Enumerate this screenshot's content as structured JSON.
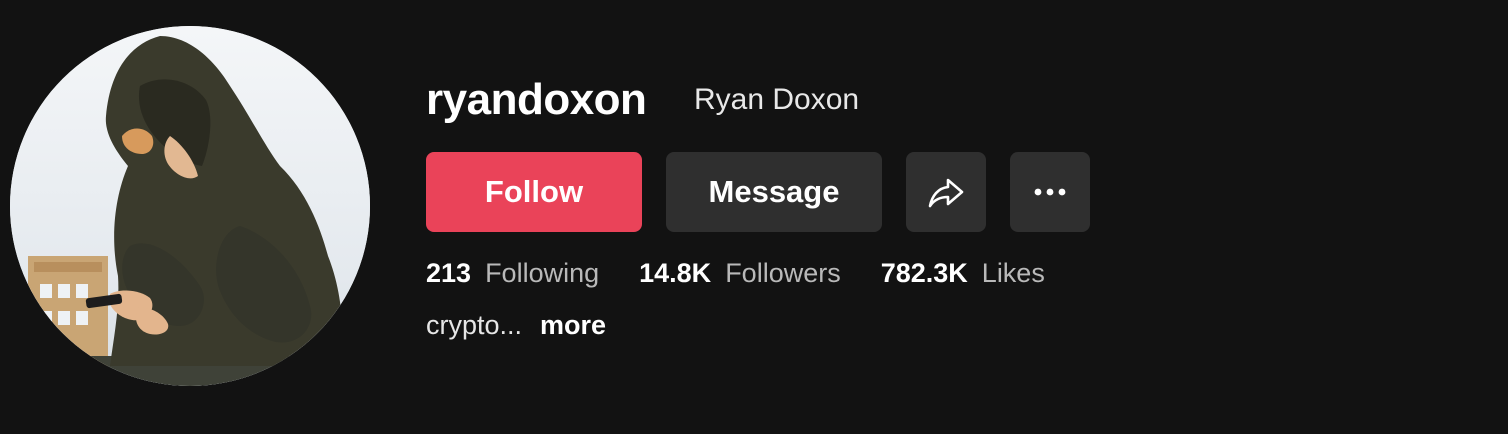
{
  "profile": {
    "username": "ryandoxon",
    "nickname": "Ryan Doxon",
    "avatar_alt": "profile photo of person in hoodie looking at phone"
  },
  "actions": {
    "follow_label": "Follow",
    "message_label": "Message",
    "share_icon": "share-arrow-icon",
    "more_icon": "ellipsis-icon"
  },
  "stats": {
    "following": {
      "value": "213",
      "label": "Following"
    },
    "followers": {
      "value": "14.8K",
      "label": "Followers"
    },
    "likes": {
      "value": "782.3K",
      "label": "Likes"
    }
  },
  "bio": {
    "text": "crypto...",
    "more_label": "more"
  },
  "colors": {
    "background": "#121212",
    "follow": "#ea4359",
    "secondary_button": "#2f2f2f"
  }
}
